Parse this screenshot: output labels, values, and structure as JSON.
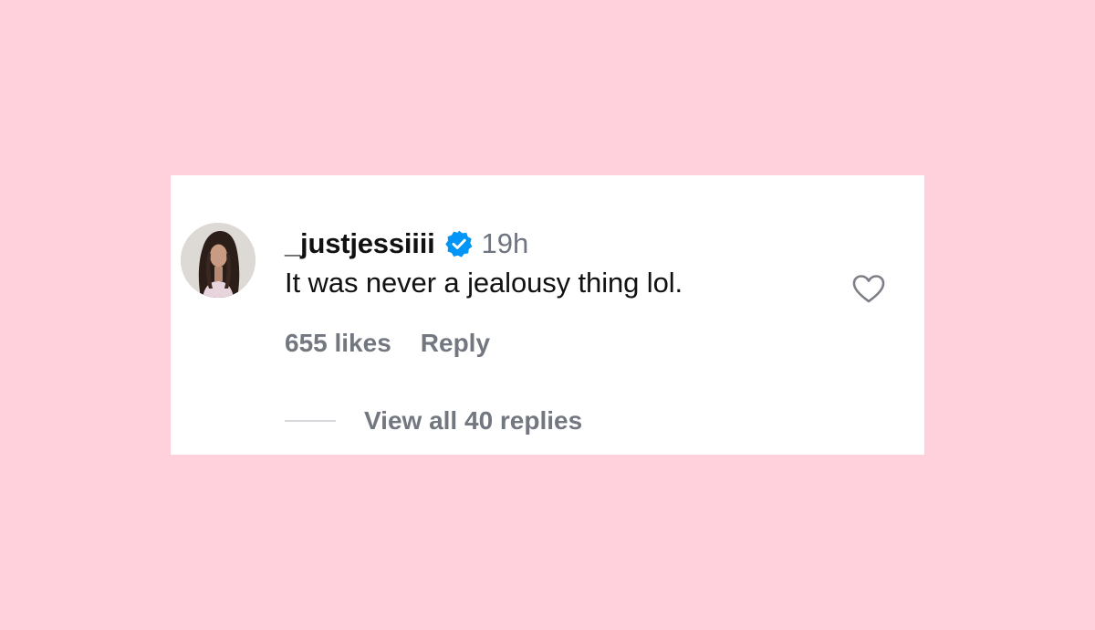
{
  "comment": {
    "username": "_justjessiiii",
    "timestamp": "19h",
    "text": "It was never a jealousy thing lol.",
    "likes_label": "655 likes",
    "reply_label": "Reply",
    "view_replies_label": "View all 40 replies",
    "verified_icon": "verified-badge-icon",
    "like_icon": "heart-outline-icon"
  },
  "colors": {
    "background": "#ffd1dc",
    "card": "#ffffff",
    "verified": "#0095f6",
    "muted_text": "#737780"
  }
}
